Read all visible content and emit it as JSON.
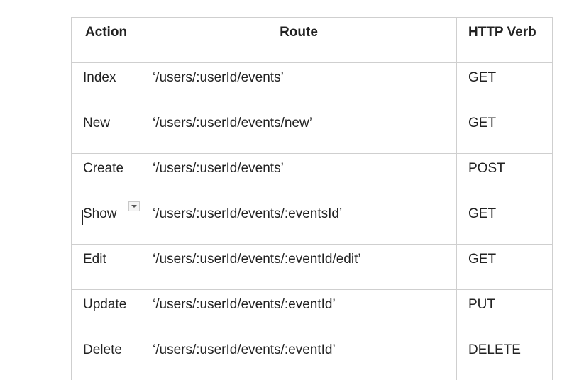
{
  "table": {
    "headers": [
      "Action",
      "Route",
      "HTTP Verb"
    ],
    "rows": [
      {
        "action": "Index",
        "route": "‘/users/:userId/events’",
        "verb": "GET"
      },
      {
        "action": "New",
        "route": "‘/users/:userId/events/new’",
        "verb": "GET"
      },
      {
        "action": "Create",
        "route": "‘/users/:userId/events’",
        "verb": "POST"
      },
      {
        "action": "Show",
        "route": "‘/users/:userId/events/:eventsId’",
        "verb": "GET"
      },
      {
        "action": "Edit",
        "route": "‘/users/:userId/events/:eventId/edit’",
        "verb": "GET"
      },
      {
        "action": "Update",
        "route": "‘/users/:userId/events/:eventId’",
        "verb": "PUT"
      },
      {
        "action": "Delete",
        "route": "‘/users/:userId/events/:eventId’",
        "verb": "DELETE"
      }
    ]
  },
  "icons": {
    "cell_menu": "chevron-down-icon"
  }
}
